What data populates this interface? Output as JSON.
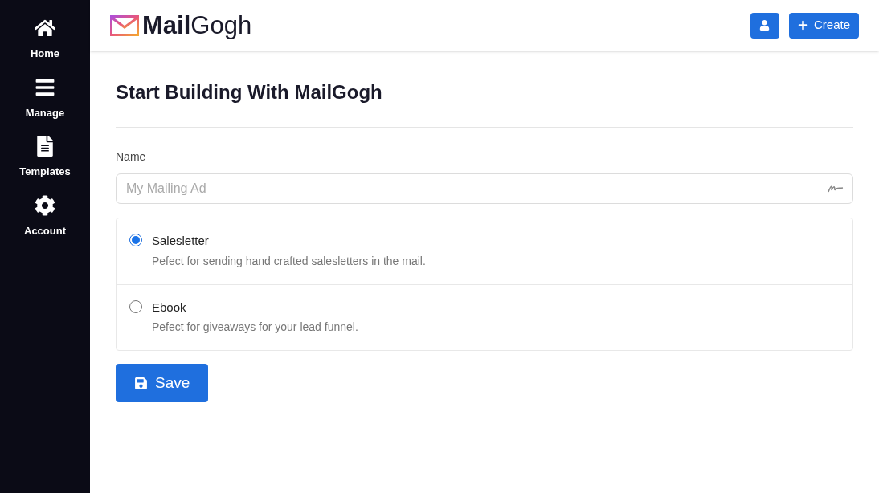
{
  "sidebar": {
    "items": [
      {
        "kind": "home",
        "label": "Home"
      },
      {
        "kind": "menu",
        "label": "Manage"
      },
      {
        "kind": "document",
        "label": "Templates"
      },
      {
        "kind": "gear",
        "label": "Account"
      }
    ]
  },
  "header": {
    "logo": "**Mail**Gogh",
    "create_button": "Create"
  },
  "title": "Start Building With MailGogh",
  "name_field": {
    "label": "Name",
    "placeholder": "My Mailing Ad"
  },
  "options": [
    {
      "title": "Salesletter",
      "description": "Pefect for sending hand crafted salesletters in the mail.",
      "selected": true
    },
    {
      "title": "Ebook",
      "description": "Pefect for giveaways for your lead funnel.",
      "selected": false
    }
  ],
  "save_button": "Save"
}
